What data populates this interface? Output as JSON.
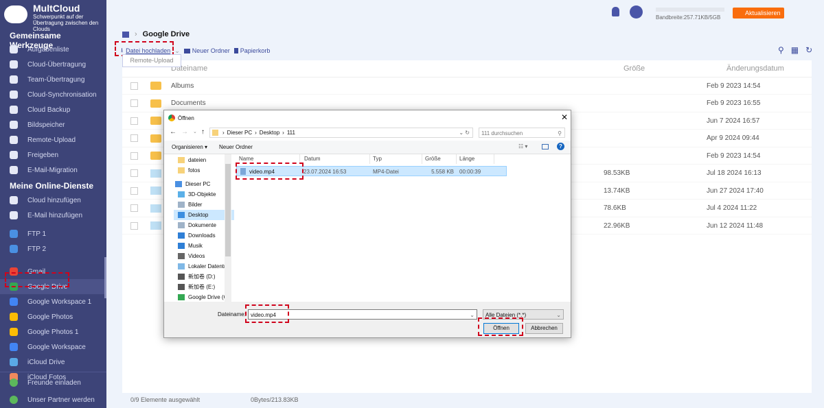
{
  "brand": {
    "name": "MultCloud",
    "tagline": "Schwerpunkt auf der Übertragung zwischen den Clouds"
  },
  "sidebar": {
    "section1": "Gemeinsame Werkzeuge",
    "tools": [
      "Aufgabenliste",
      "Cloud-Übertragung",
      "Team-Übertragung",
      "Cloud-Synchronisation",
      "Cloud Backup",
      "Bildspeicher",
      "Remote-Upload",
      "Freigeben",
      "E-Mail-Migration"
    ],
    "section2": "Meine Online-Dienste",
    "services": [
      "Cloud hinzufügen",
      "E-Mail hinzufügen",
      "FTP 1",
      "FTP 2",
      "Gmail",
      "Google Drive",
      "Google Workspace 1",
      "Google Photos",
      "Google Photos 1",
      "Google Workspace",
      "iCloud Drive",
      "iCloud Fotos"
    ],
    "active": "Google Drive",
    "footer": [
      "Freunde einladen",
      "Unser Partner werden"
    ]
  },
  "header": {
    "bandwidth": "Bandbreite:257.71KB/5GB",
    "upgrade": "Aktualisieren"
  },
  "breadcrumb": {
    "current": "Google Drive"
  },
  "toolbar": {
    "upload": "Datei hochladen",
    "remote_upload": "Remote-Upload",
    "new_folder": "Neuer Ordner",
    "trash": "Papierkorb"
  },
  "table": {
    "headers": {
      "name": "Dateiname",
      "size": "Größe",
      "date": "Änderungsdatum"
    },
    "rows": [
      {
        "name": "Albums",
        "size": "",
        "date": "Feb 9 2023 14:54",
        "type": "folder"
      },
      {
        "name": "Documents",
        "size": "",
        "date": "Feb 9 2023 16:55",
        "type": "folder"
      },
      {
        "name": "",
        "size": "",
        "date": "Jun 7 2024 16:57",
        "type": "folder"
      },
      {
        "name": "",
        "size": "",
        "date": "Apr 9 2024 09:44",
        "type": "folder"
      },
      {
        "name": "",
        "size": "",
        "date": "Feb 9 2023 14:54",
        "type": "folder"
      },
      {
        "name": "",
        "size": "98.53KB",
        "date": "Jul 18 2024 16:13",
        "type": "image"
      },
      {
        "name": "",
        "size": "13.74KB",
        "date": "Jun 27 2024 17:40",
        "type": "image"
      },
      {
        "name": "",
        "size": "78.6KB",
        "date": "Jul 4 2024 11:22",
        "type": "image"
      },
      {
        "name": "",
        "size": "22.96KB",
        "date": "Jun 12 2024 11:48",
        "type": "image"
      }
    ]
  },
  "status": {
    "selected": "0/9 Elemente ausgewählt",
    "size": "0Bytes/213.83KB"
  },
  "dialog": {
    "title": "Öffnen",
    "path": [
      "Dieser PC",
      "Desktop",
      "111"
    ],
    "search_placeholder": "111 durchsuchen",
    "organize": "Organisieren ▾",
    "new_folder": "Neuer Ordner",
    "tree": [
      "dateien",
      "fotos",
      "Dieser PC",
      "3D-Objekte",
      "Bilder",
      "Desktop",
      "Dokumente",
      "Downloads",
      "Musik",
      "Videos",
      "Lokaler Datenträ",
      "新加卷 (D:)",
      "新加卷 (E:)",
      "Google Drive (G:"
    ],
    "columns": [
      "Name",
      "Datum",
      "Typ",
      "Größe",
      "Länge"
    ],
    "file": {
      "name": "video.mp4",
      "date": "23.07.2024 16:53",
      "type": "MP4-Datei",
      "size": "5.558 KB",
      "length": "00:00:39"
    },
    "filename_label": "Dateiname:",
    "filename": "video.mp4",
    "filter": "Alle Dateien (*.*)",
    "open": "Öffnen",
    "cancel": "Abbrechen"
  }
}
